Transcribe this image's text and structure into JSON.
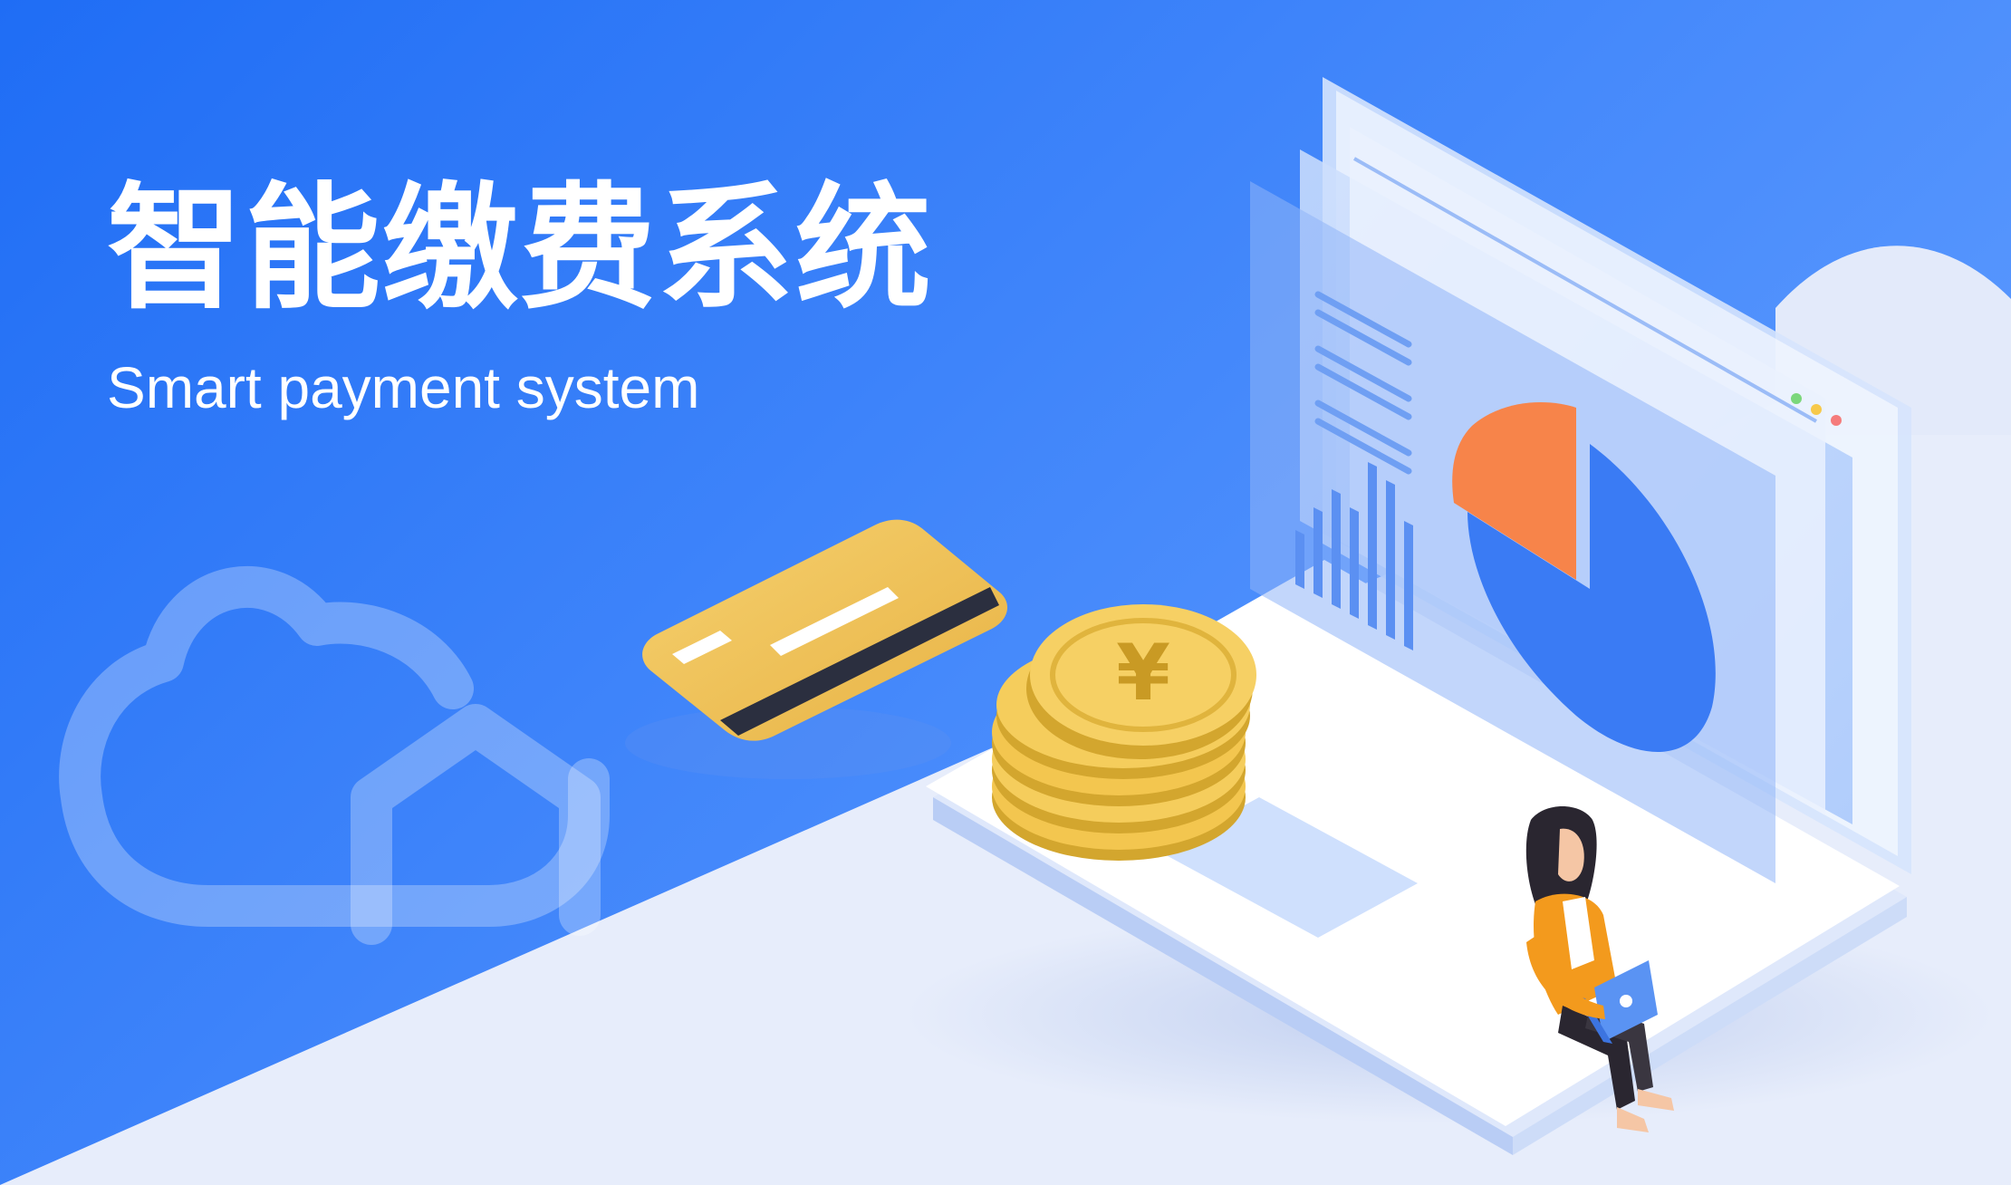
{
  "hero": {
    "title": "智能缴费系统",
    "subtitle": "Smart payment system"
  },
  "illustration": {
    "cloud": "cloud-house-icon",
    "card": "credit-card-icon",
    "coins": "yuan-coin-stack-icon",
    "coin_symbol": "¥",
    "laptop": "laptop-icon",
    "pie_chart": "pie-chart-icon",
    "bar_chart": "bar-chart-icon",
    "person": "person-with-laptop-icon"
  },
  "colors": {
    "background_blue": "#2c7bf6",
    "background_light": "#e8eefb",
    "card_gold": "#f1c35a",
    "coin_gold": "#f3c64f",
    "pie_orange": "#f7844a",
    "pie_blue": "#3b7cf5",
    "screen_blue": "#a9c8fb",
    "laptop_white": "#ffffff",
    "person_orange": "#f39a1d"
  }
}
